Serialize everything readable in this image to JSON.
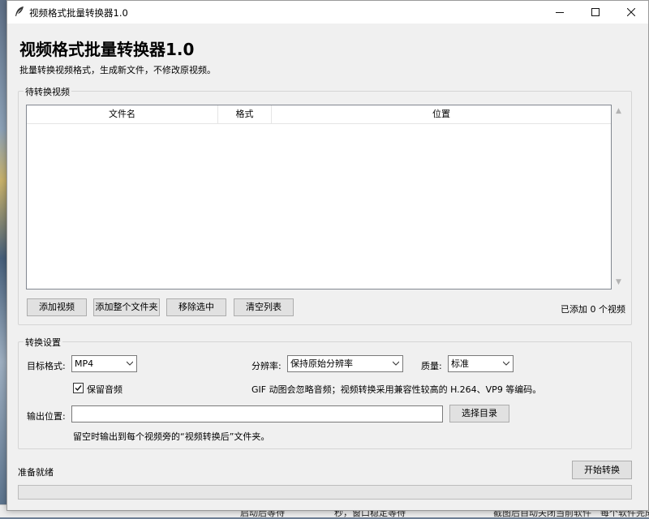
{
  "window": {
    "title": "视频格式批量转换器1.0",
    "heading": "视频格式批量转换器1.0",
    "subheading": "批量转换视频格式，生成新文件，不修改原视频。"
  },
  "queue": {
    "group_label": "待转换视频",
    "columns": [
      "文件名",
      "格式",
      "位置"
    ],
    "rows": [],
    "buttons": {
      "add_videos": "添加视频",
      "add_folder": "添加整个文件夹",
      "remove_selected": "移除选中",
      "clear_list": "清空列表"
    },
    "count_text": "已添加 0 个视频"
  },
  "settings": {
    "group_label": "转换设置",
    "target_format_label": "目标格式:",
    "target_format_value": "MP4",
    "resolution_label": "分辨率:",
    "resolution_value": "保持原始分辨率",
    "quality_label": "质量:",
    "quality_value": "标准",
    "keep_audio_label": "保留音频",
    "keep_audio_checked": true,
    "note": "GIF 动图会忽略音频；视频转换采用兼容性较高的 H.264、VP9 等编码。",
    "output_label": "输出位置:",
    "output_value": "",
    "choose_dir_button": "选择目录",
    "output_hint": "留空时输出到每个视频旁的“视频转换后”文件夹。"
  },
  "footer": {
    "status": "准备就绪",
    "start_button": "开始转换",
    "progress": 0
  },
  "background_taskbar": {
    "text1": "启动后等待",
    "text2": "秒，窗口稳定等待",
    "text3": "截图后自动关闭当前软件",
    "text4": "每个软件完成"
  },
  "colors": {
    "window_bg": "#f0f0f0",
    "progress_fill": "#06b025",
    "button_bg": "#e1e1e1"
  },
  "icons": {
    "app": "feather-icon",
    "minimize": "minimize-icon",
    "maximize": "maximize-icon",
    "close": "close-icon"
  }
}
